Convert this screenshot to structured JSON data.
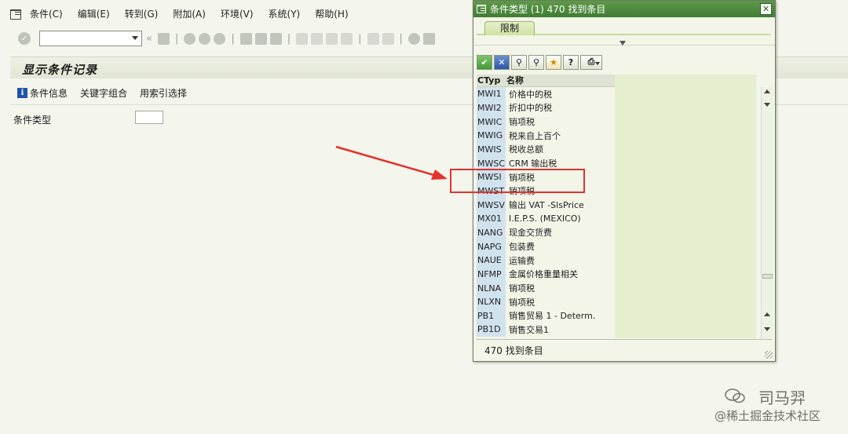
{
  "menu": {
    "items": [
      "条件(C)",
      "编辑(E)",
      "转到(G)",
      "附加(A)",
      "环境(V)",
      "系统(Y)",
      "帮助(H)"
    ]
  },
  "page": {
    "title": "显示条件记录"
  },
  "app_toolbar": {
    "condition_info": "条件信息",
    "key_combination": "关键字组合",
    "index_selection": "用索引选择"
  },
  "form": {
    "condition_type_label": "条件类型",
    "condition_type_value": ""
  },
  "popup": {
    "title": "条件类型 (1)  470 找到条目",
    "close": "✕",
    "tab_label": "限制",
    "columns": [
      "CTyp",
      "名称"
    ],
    "rows": [
      {
        "code": "MWI1",
        "name": "价格中的税"
      },
      {
        "code": "MWI2",
        "name": "折扣中的税"
      },
      {
        "code": "MWIC",
        "name": "销项税"
      },
      {
        "code": "MWIG",
        "name": "税来自上百个"
      },
      {
        "code": "MWIS",
        "name": "税收总额"
      },
      {
        "code": "MWSC",
        "name": "CRM 输出税"
      },
      {
        "code": "MWSI",
        "name": "销项税"
      },
      {
        "code": "MWST",
        "name": "销项税"
      },
      {
        "code": "MWSV",
        "name": "输出 VAT -SlsPrice"
      },
      {
        "code": "MX01",
        "name": "I.E.P.S.  (MEXICO)"
      },
      {
        "code": "NANG",
        "name": "现金交货费"
      },
      {
        "code": "NAPG",
        "name": "包装费"
      },
      {
        "code": "NAUE",
        "name": "运输费"
      },
      {
        "code": "NFMP",
        "name": "金属价格重量相关"
      },
      {
        "code": "NLNA",
        "name": "销项税"
      },
      {
        "code": "NLXN",
        "name": "销项税"
      },
      {
        "code": "PB1",
        "name": "销售贸易 1 - Determ."
      },
      {
        "code": "PB1D",
        "name": "销售交易1"
      }
    ],
    "status": "470 找到条目",
    "highlighted_code": "MWSI",
    "annotation_color": "#e3322b"
  },
  "watermark": {
    "name": "司马羿",
    "sub": "@稀土掘金技术社区"
  }
}
